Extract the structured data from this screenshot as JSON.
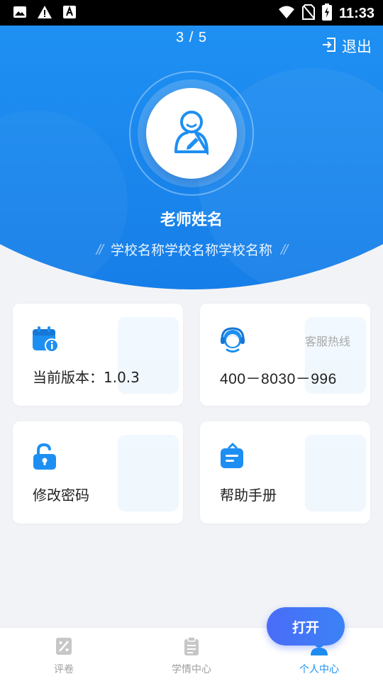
{
  "status_bar": {
    "time": "11:33",
    "icons": [
      "image-icon",
      "warning-icon",
      "font-icon",
      "wifi-icon",
      "no-sim-icon",
      "battery-charging-icon"
    ]
  },
  "header": {
    "page_indicator": "3 / 5",
    "logout_label": "退出",
    "logout_icon": "logout-icon",
    "avatar_icon": "teacher-avatar-icon",
    "teacher_name": "老师姓名",
    "school_name": "学校名称学校名称学校名称",
    "school_deco_left": "//",
    "school_deco_right": "//"
  },
  "cards": {
    "version": {
      "icon": "calendar-info-icon",
      "label": "当前版本：1.0.3"
    },
    "hotline": {
      "icon": "customer-service-icon",
      "caption": "客服热线",
      "number": "400－8030－996"
    },
    "password": {
      "icon": "unlock-icon",
      "label": "修改密码"
    },
    "help": {
      "icon": "manual-icon",
      "label": "帮助手册"
    }
  },
  "fab": {
    "label": "打开"
  },
  "bottom_nav": {
    "items": [
      {
        "label": "评卷",
        "icon": "grading-icon",
        "active": false
      },
      {
        "label": "学情中心",
        "icon": "clipboard-icon",
        "active": false
      },
      {
        "label": "个人中心",
        "icon": "person-icon",
        "active": true
      }
    ]
  },
  "colors": {
    "primary": "#1e8ff2",
    "primary_light": "#36a8f8",
    "fab": "#4a6cf7",
    "page_bg": "#f2f3f7"
  }
}
